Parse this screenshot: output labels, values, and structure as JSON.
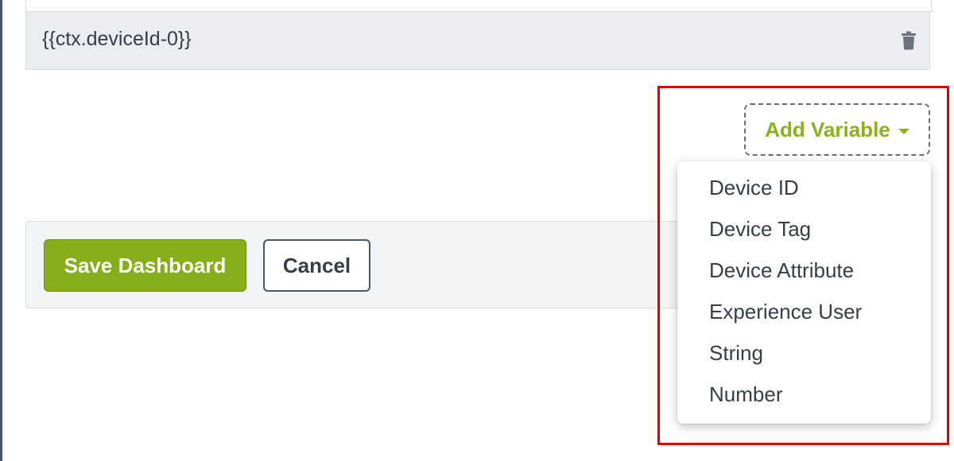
{
  "variable_row": {
    "text": "{{ctx.deviceId-0}}"
  },
  "icons": {
    "trash": "trash-icon",
    "caret": "caret-down-icon"
  },
  "add_variable": {
    "label": "Add Variable"
  },
  "dropdown": {
    "items": [
      "Device ID",
      "Device Tag",
      "Device Attribute",
      "Experience User",
      "String",
      "Number"
    ]
  },
  "footer": {
    "save_label": "Save Dashboard",
    "cancel_label": "Cancel"
  },
  "colors": {
    "accent_green": "#86ae17",
    "highlight_red": "#e00000"
  }
}
